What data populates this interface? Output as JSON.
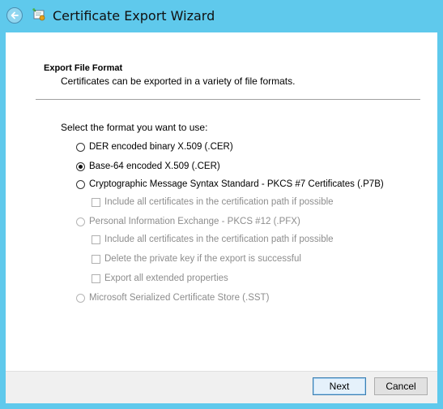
{
  "window": {
    "title": "Certificate Export Wizard"
  },
  "icons": {
    "back": "back-arrow-icon",
    "app": "certificate-wizard-icon"
  },
  "section": {
    "heading": "Export File Format",
    "description": "Certificates can be exported in a variety of file formats."
  },
  "prompt": "Select the format you want to use:",
  "options": [
    {
      "label": "DER encoded binary X.509 (.CER)",
      "selected": false,
      "enabled": true
    },
    {
      "label": "Base-64 encoded X.509 (.CER)",
      "selected": true,
      "enabled": true
    },
    {
      "label": "Cryptographic Message Syntax Standard - PKCS #7 Certificates (.P7B)",
      "selected": false,
      "enabled": true
    },
    {
      "label": "Personal Information Exchange - PKCS #12 (.PFX)",
      "selected": false,
      "enabled": false
    },
    {
      "label": "Microsoft Serialized Certificate Store (.SST)",
      "selected": false,
      "enabled": false
    }
  ],
  "p7b_options": {
    "include_all": "Include all certificates in the certification path if possible"
  },
  "pfx_options": {
    "include_all": "Include all certificates in the certification path if possible",
    "delete_key": "Delete the private key if the export is successful",
    "export_props": "Export all extended properties"
  },
  "buttons": {
    "next": "Next",
    "cancel": "Cancel"
  },
  "colors": {
    "window_frame": "#5fc9ec",
    "footer": "#f0f0f0",
    "disabled_text": "#8d8d8d"
  }
}
